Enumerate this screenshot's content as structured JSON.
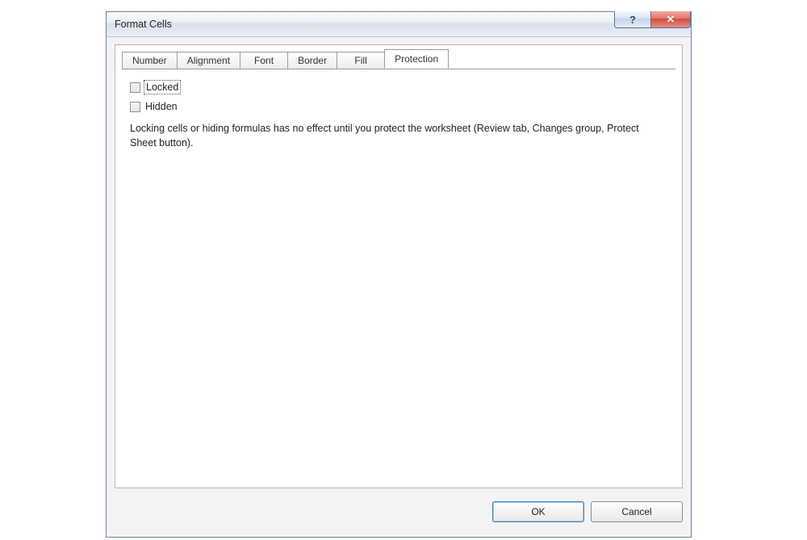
{
  "window": {
    "title": "Format Cells",
    "help_glyph": "?",
    "close_glyph": "✕"
  },
  "tabs": {
    "t0": "Number",
    "t1": "Alignment",
    "t2": "Font",
    "t3": "Border",
    "t4": "Fill",
    "t5": "Protection"
  },
  "protection": {
    "locked_label": "Locked",
    "hidden_label": "Hidden",
    "note": "Locking cells or hiding formulas has no effect until you protect the worksheet (Review tab, Changes group, Protect Sheet button)."
  },
  "buttons": {
    "ok": "OK",
    "cancel": "Cancel"
  }
}
